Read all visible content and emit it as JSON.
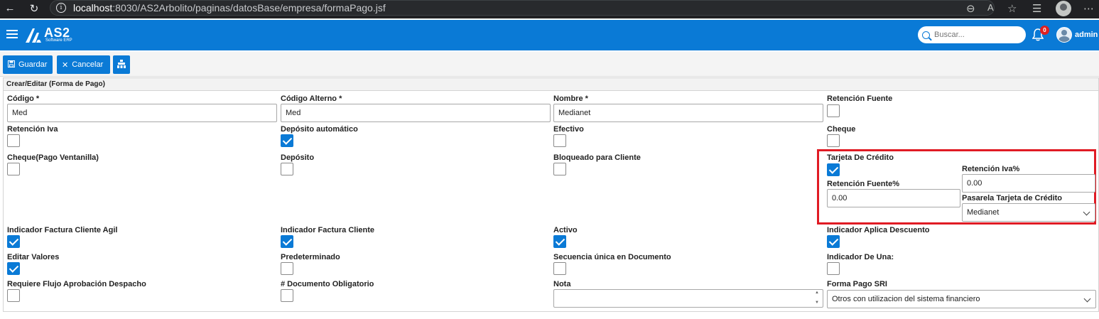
{
  "browser": {
    "url_host": "localhost",
    "url_path": ":8030/AS2Arbolito/paginas/datosBase/empresa/formaPago.jsf"
  },
  "header": {
    "logo_title": "AS2",
    "logo_subtitle": "Software ERP",
    "search_placeholder": "Buscar...",
    "notification_count": "0",
    "user_name": "admin",
    "brand_color": "#0a7ad6"
  },
  "toolbar": {
    "save_label": "Guardar",
    "cancel_label": "Cancelar"
  },
  "panel": {
    "title": "Crear/Editar (Forma de Pago)"
  },
  "fields": {
    "codigo_label": "Código *",
    "codigo_value": "Med",
    "codigo_alterno_label": "Código Alterno *",
    "codigo_alterno_value": "Med",
    "nombre_label": "Nombre *",
    "nombre_value": "Medianet",
    "retencion_fuente_label": "Retención Fuente",
    "retencion_fuente_checked": false,
    "retencion_iva_label": "Retención Iva",
    "retencion_iva_checked": false,
    "deposito_automatico_label": "Depósito automático",
    "deposito_automatico_checked": true,
    "efectivo_label": "Efectivo",
    "efectivo_checked": false,
    "cheque_label": "Cheque",
    "cheque_checked": false,
    "cheque_pago_ventanilla_label": "Cheque(Pago Ventanilla)",
    "cheque_pago_ventanilla_checked": false,
    "deposito_label": "Depósito",
    "deposito_checked": false,
    "bloqueado_cliente_label": "Bloqueado para Cliente",
    "bloqueado_cliente_checked": false,
    "tarjeta_credito_label": "Tarjeta De Crédito",
    "tarjeta_credito_checked": true,
    "retencion_iva_pct_label": "Retención Iva%",
    "retencion_iva_pct_value": "0.00",
    "retencion_fuente_pct_label": "Retención Fuente%",
    "retencion_fuente_pct_value": "0.00",
    "pasarela_label": "Pasarela Tarjeta de Crédito",
    "pasarela_value": "Medianet",
    "ind_factura_cliente_agil_label": "Indicador Factura Cliente Agil",
    "ind_factura_cliente_agil_checked": true,
    "ind_factura_cliente_label": "Indicador Factura Cliente",
    "ind_factura_cliente_checked": true,
    "activo_label": "Activo",
    "activo_checked": true,
    "ind_aplica_descuento_label": "Indicador Aplica Descuento",
    "ind_aplica_descuento_checked": true,
    "editar_valores_label": "Editar Valores",
    "editar_valores_checked": true,
    "predeterminado_label": "Predeterminado",
    "predeterminado_checked": false,
    "secuencia_unica_label": "Secuencia única en Documento",
    "secuencia_unica_checked": false,
    "ind_de_una_label": "Indicador De Una:",
    "ind_de_una_checked": false,
    "requiere_flujo_label": "Requiere Flujo Aprobación Despacho",
    "requiere_flujo_checked": false,
    "doc_obligatorio_label": "# Documento Obligatorio",
    "doc_obligatorio_checked": false,
    "nota_label": "Nota",
    "nota_value": "",
    "forma_pago_sri_label": "Forma Pago SRI",
    "forma_pago_sri_value": "Otros con utilizacion del sistema financiero"
  },
  "highlight_color": "#e01b24"
}
